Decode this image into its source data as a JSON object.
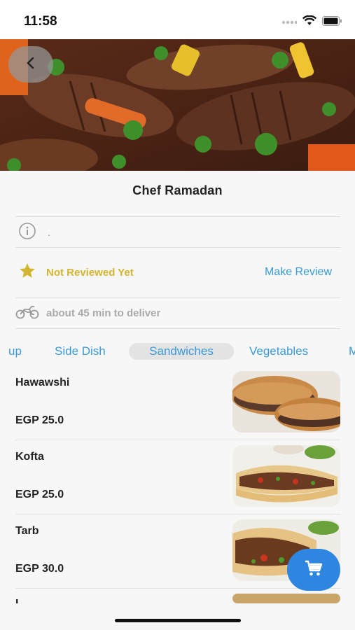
{
  "status_bar": {
    "time": "11:58"
  },
  "chef": {
    "name": "Chef Ramadan"
  },
  "info": {
    "description": "."
  },
  "review": {
    "status": "Not Reviewed Yet",
    "action": "Make Review"
  },
  "delivery": {
    "text": "about 45 min to deliver"
  },
  "categories": [
    {
      "label": "up"
    },
    {
      "label": "Side Dish"
    },
    {
      "label": "Sandwiches",
      "active": true
    },
    {
      "label": "Vegetables"
    },
    {
      "label": "M"
    }
  ],
  "menu": [
    {
      "name": "Hawawshi",
      "price": "EGP 25.0",
      "image": "hawawshi-image"
    },
    {
      "name": "Kofta",
      "price": "EGP 25.0",
      "image": "kofta-sandwich-image"
    },
    {
      "name": "Tarb",
      "price": "EGP 30.0",
      "image": "tarb-sandwich-image"
    },
    {
      "name": "L",
      "price": "",
      "image": "sandwich-image"
    }
  ],
  "colors": {
    "accent_blue": "#3a9ad8",
    "review_gold": "#d4b52f",
    "fab_blue": "#2e86e0"
  }
}
